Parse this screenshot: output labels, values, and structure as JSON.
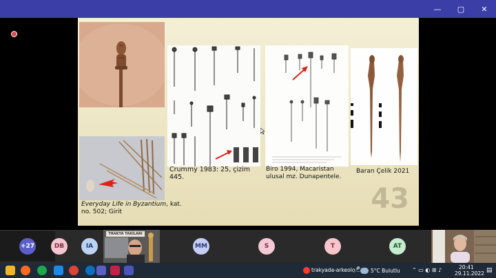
{
  "window": {
    "controls": {
      "minimize": "—",
      "maximize": "▢",
      "close": "✕"
    }
  },
  "slide": {
    "captions": {
      "everyday_title": "Everyday Life in Byzantium",
      "everyday_rest": ", kat. no. 502; Girit",
      "crummy": "Crummy 1983: 25, çizim 445.",
      "biro": "Biro 1994, Macaristan ulusal mz. Dunapentele.",
      "celik": "Baran Çelik 2021"
    },
    "slide_number": "43"
  },
  "participants": [
    {
      "initials": "+27",
      "color": "#5b5fc7"
    },
    {
      "initials": "DB",
      "color": "#f4c6d2"
    },
    {
      "initials": "IA",
      "color": "#bcd3f4"
    },
    {
      "initials": "MM",
      "color": "#c5cff5"
    },
    {
      "initials": "S",
      "color": "#f2c9d4"
    },
    {
      "initials": "T",
      "color": "#f7c6cd"
    },
    {
      "initials": "AT",
      "color": "#c6ebcf"
    }
  ],
  "video_tile_top": {
    "banner": "TRAKYA TAKILARI"
  },
  "taskbar": {
    "teams_label": "trakyada-arkeolo...",
    "weather": "5°C  Bulutlu",
    "time": "20:41",
    "date": "29.11.2022"
  },
  "colors": {
    "titlebar": "#3b3ea6",
    "taskbar": "#1f2a38",
    "slide_bg": "#f0ead0"
  }
}
